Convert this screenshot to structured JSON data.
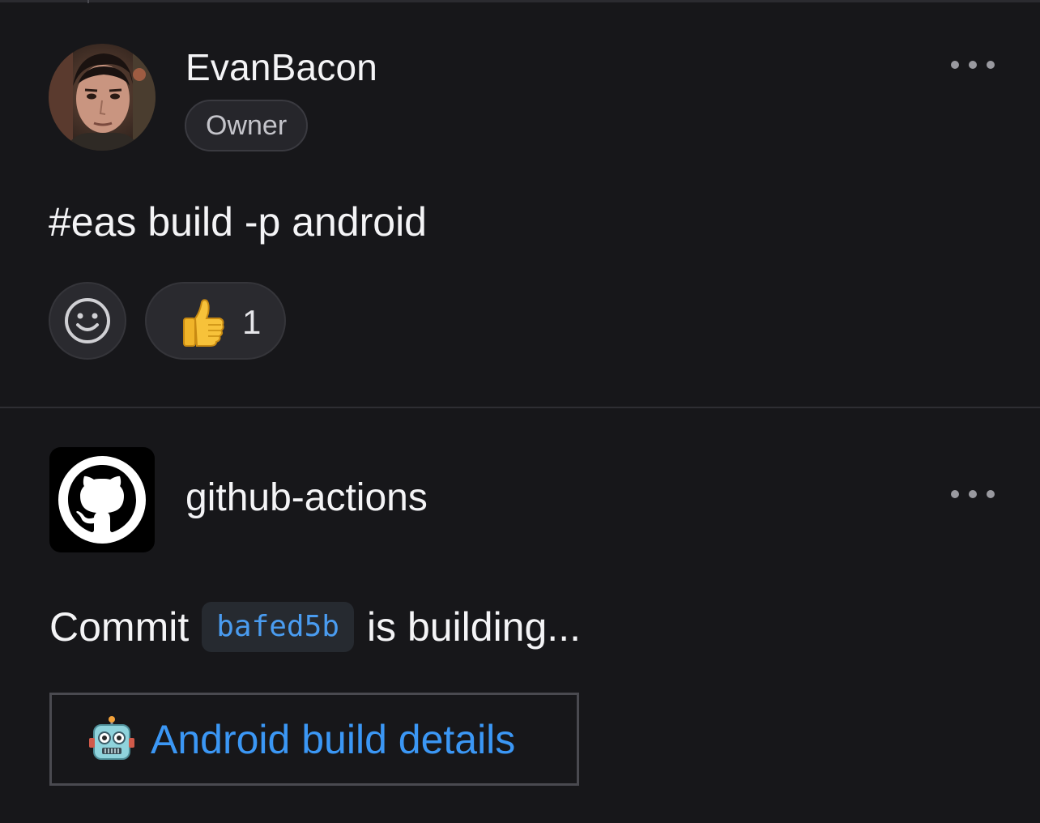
{
  "comment1": {
    "author": "EvanBacon",
    "role_badge": "Owner",
    "body": "#eas build -p android",
    "reactions": [
      {
        "emoji": "thumbs-up",
        "count": "1"
      }
    ],
    "avatar_icon": "user-avatar-photo",
    "menu_icon": "more-horizontal-icon"
  },
  "comment2": {
    "author": "github-actions",
    "body_prefix": "Commit",
    "commit_sha": "bafed5b",
    "body_suffix": "is building...",
    "link_label": "Android build details",
    "link_emoji": "robot-icon",
    "avatar_icon": "github-octocat-icon",
    "menu_icon": "more-horizontal-icon"
  },
  "colors": {
    "background": "#17171a",
    "link": "#3b97f5",
    "code": "#4a9cf0"
  }
}
